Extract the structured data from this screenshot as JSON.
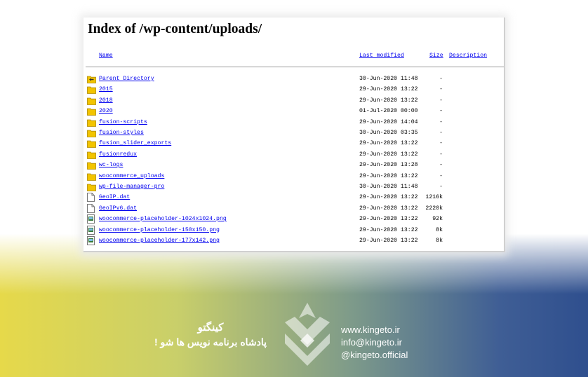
{
  "listing": {
    "title": "Index of /wp-content/uploads/",
    "columns": {
      "name": "Name",
      "modified": "Last modified",
      "size": "Size",
      "description": "Description"
    },
    "rows": [
      {
        "icon": "back-folder-icon",
        "name": "Parent Directory",
        "modified": "30-Jun-2020 11:48",
        "size": "-"
      },
      {
        "icon": "folder-icon",
        "name": "2015",
        "modified": "29-Jun-2020 13:22",
        "size": "-"
      },
      {
        "icon": "folder-icon",
        "name": "2018",
        "modified": "29-Jun-2020 13:22",
        "size": "-"
      },
      {
        "icon": "folder-icon",
        "name": "2020",
        "modified": "01-Jul-2020 00:00",
        "size": "-"
      },
      {
        "icon": "folder-icon",
        "name": "fusion-scripts",
        "modified": "29-Jun-2020 14:04",
        "size": "-"
      },
      {
        "icon": "folder-icon",
        "name": "fusion-styles",
        "modified": "30-Jun-2020 03:35",
        "size": "-"
      },
      {
        "icon": "folder-icon",
        "name": "fusion_slider_exports",
        "modified": "29-Jun-2020 13:22",
        "size": "-"
      },
      {
        "icon": "folder-icon",
        "name": "fusionredux",
        "modified": "29-Jun-2020 13:22",
        "size": "-"
      },
      {
        "icon": "folder-icon",
        "name": "wc-logs",
        "modified": "29-Jun-2020 13:28",
        "size": "-"
      },
      {
        "icon": "folder-icon",
        "name": "woocommerce_uploads",
        "modified": "29-Jun-2020 13:22",
        "size": "-"
      },
      {
        "icon": "folder-icon",
        "name": "wp-file-manager-pro",
        "modified": "30-Jun-2020 11:48",
        "size": "-"
      },
      {
        "icon": "file-icon",
        "name": "GeoIP.dat",
        "modified": "29-Jun-2020 13:22",
        "size": "1216k"
      },
      {
        "icon": "file-icon",
        "name": "GeoIPv6.dat",
        "modified": "29-Jun-2020 13:22",
        "size": "2220k"
      },
      {
        "icon": "image-file-icon",
        "name": "woocommerce-placeholder-1024x1024.png",
        "modified": "29-Jun-2020 13:22",
        "size": "92k"
      },
      {
        "icon": "image-file-icon",
        "name": "woocommerce-placeholder-150x150.png",
        "modified": "29-Jun-2020 13:22",
        "size": "8k"
      },
      {
        "icon": "image-file-icon",
        "name": "woocommerce-placeholder-177x142.png",
        "modified": "29-Jun-2020 13:22",
        "size": "8k"
      }
    ]
  },
  "branding": {
    "name_fa": "کینگتو",
    "slogan_fa": "پادشاه برنامه نویس ها شو !",
    "website": "www.kingeto.ir",
    "email": "info@kingeto.ir",
    "social": "@kingeto.official"
  },
  "colors": {
    "link": "#0000ee",
    "folder": "#f2c400",
    "background_left": "#e6d94a",
    "background_right": "#2f4f8e"
  }
}
